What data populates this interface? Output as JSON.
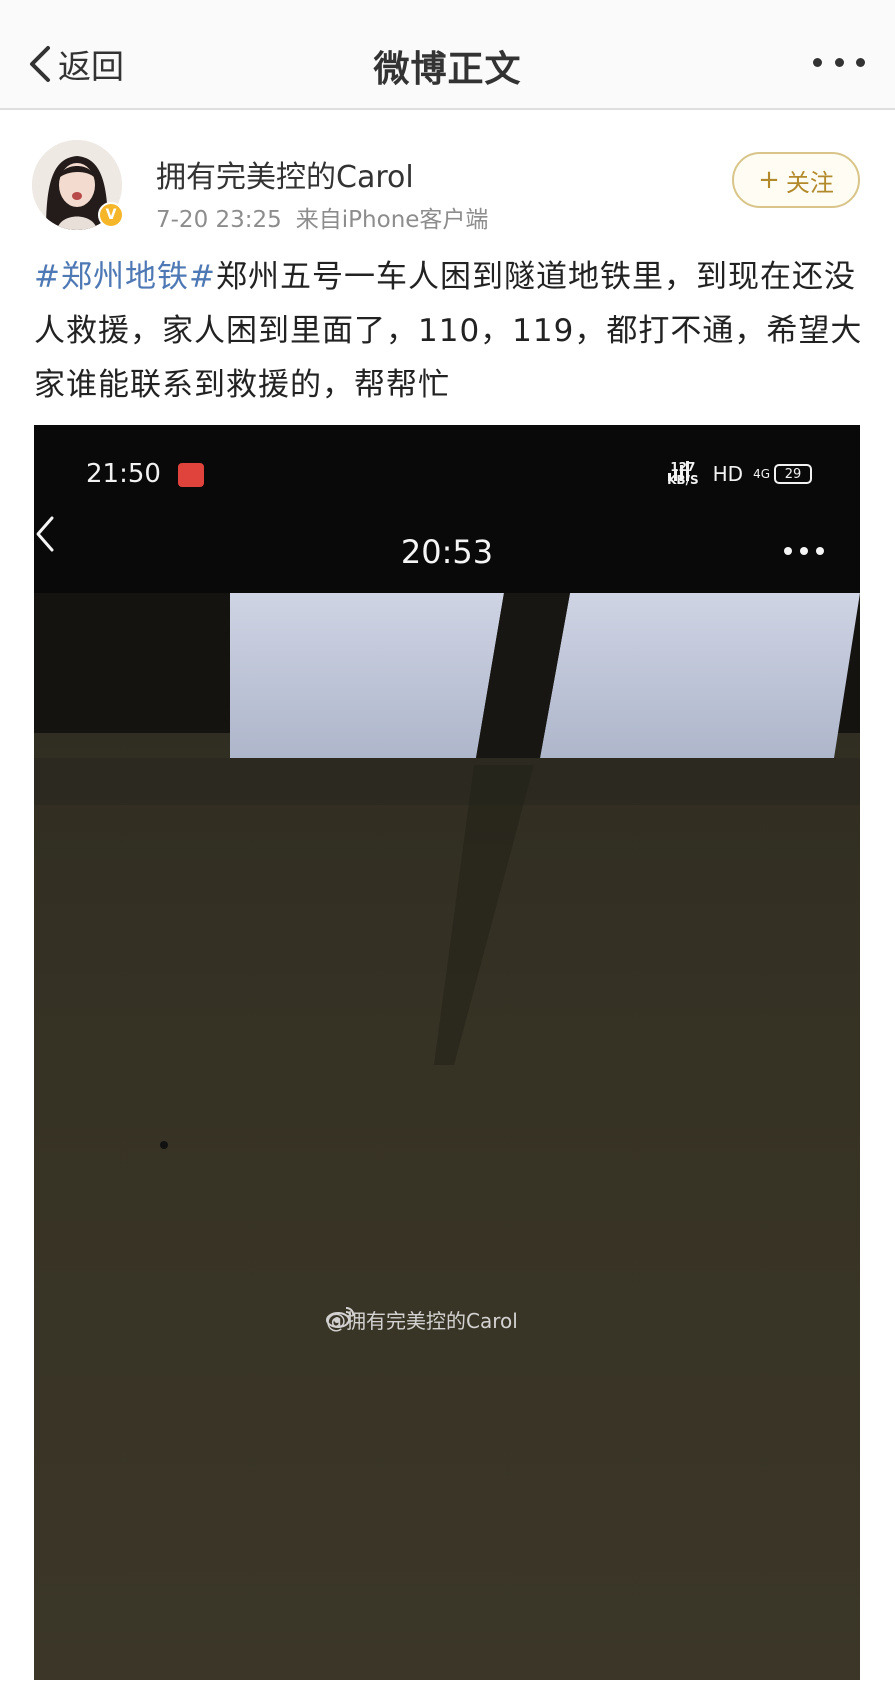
{
  "nav": {
    "back_label": "返回",
    "title": "微博正文"
  },
  "post": {
    "author": "拥有完美控的Carol",
    "timestamp": "7-20 23:25",
    "source": "来自iPhone客户端",
    "follow_label": "关注",
    "follow_plus": "+",
    "hashtag": "#郑州地铁#",
    "body": "郑州五号一车人困到隧道地铁里，到现在还没人救援，家人困到里面了，110，119，都打不通，希望大家谁能联系到救援的，帮帮忙"
  },
  "media": {
    "phone_time": "21:50",
    "net_speed_value": "127",
    "net_speed_unit": "KB/S",
    "hd_label": "HD",
    "network_label": "4G",
    "battery": "29",
    "video_time": "20:53",
    "watermark": "@拥有完美控的Carol"
  },
  "colors": {
    "hashtag": "#4f79b5",
    "follow_border": "#d9c58a",
    "follow_text": "#b28a2c",
    "verified": "#f5b62a"
  },
  "icons": [
    "chevron-left-icon",
    "more-icon",
    "verified-icon",
    "weibo-logo-icon",
    "signal-icon",
    "battery-icon"
  ]
}
